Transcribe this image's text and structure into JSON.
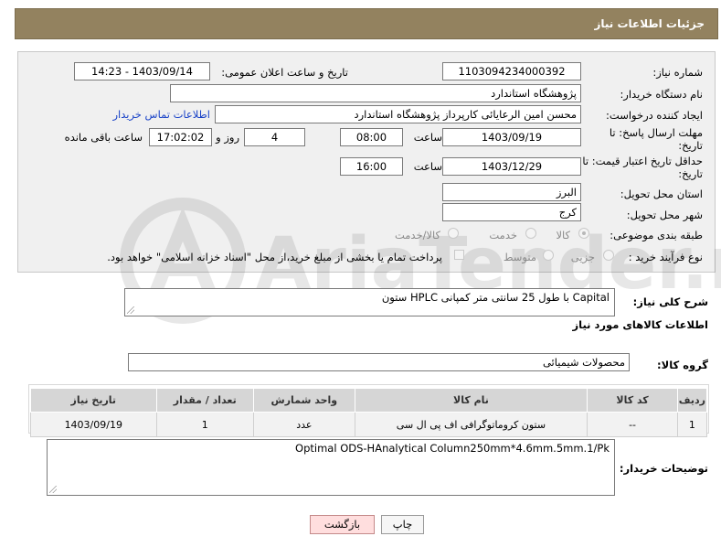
{
  "header": {
    "title": "جزئیات اطلاعات نیاز"
  },
  "form": {
    "need_number_label": "شماره نیاز:",
    "need_number": "1103094234000392",
    "announce_label": "تاریخ و ساعت اعلان عمومی:",
    "announce_value": "1403/09/14 - 14:23",
    "buyer_org_label": "نام دستگاه خریدار:",
    "buyer_org": "پژوهشگاه استاندارد",
    "creator_label": "ایجاد کننده درخواست:",
    "creator": "محسن امین الرعایائی کارپرداز پژوهشگاه استاندارد",
    "contact_link": "اطلاعات تماس خریدار",
    "reply_deadline_label": "مهلت ارسال پاسخ: تا تاریخ:",
    "reply_date": "1403/09/19",
    "time_label": "ساعت",
    "reply_time": "08:00",
    "days": "4",
    "days_label": "روز و",
    "remaining_time": "17:02:02",
    "remaining_label": "ساعت باقی مانده",
    "price_deadline_label": "حداقل تاریخ اعتبار قیمت: تا تاریخ:",
    "price_date": "1403/12/29",
    "price_time": "16:00",
    "province_label": "استان محل تحویل:",
    "province": "البرز",
    "city_label": "شهر محل تحویل:",
    "city": "کرج",
    "category_label": "طبقه بندی موضوعی:",
    "category_options": [
      "کالا",
      "خدمت",
      "کالا/خدمت"
    ],
    "process_label": "نوع فرآیند خرید :",
    "process_options": [
      "جزیی",
      "متوسط"
    ],
    "payment_note": "پرداخت تمام یا بخشی از مبلغ خرید،از محل \"اسناد خزانه اسلامی\" خواهد بود."
  },
  "description": {
    "label": "شرح کلی نیاز:",
    "text": "ستون HPLC با طول 25 سانتی متر کمپانی Capital"
  },
  "goods": {
    "section_title": "اطلاعات کالاهای مورد نیاز",
    "group_label": "گروه کالا:",
    "group_value": "محصولات شیمیائی",
    "columns": [
      "ردیف",
      "کد کالا",
      "نام کالا",
      "واحد شمارش",
      "تعداد / مقدار",
      "تاریخ نیاز"
    ],
    "rows": [
      {
        "row": "1",
        "code": "--",
        "name": "ستون کروماتوگرافی اف پی ال سی",
        "unit": "عدد",
        "qty": "1",
        "date": "1403/09/19"
      }
    ]
  },
  "buyer_notes": {
    "label": "توضیحات خریدار:",
    "text": "Optimal ODS-HAnalytical Column250mm*4.6mm.5mm.1/Pk"
  },
  "buttons": {
    "print": "چاپ",
    "back": "بازگشت"
  },
  "watermark": {
    "text": "AriaTender.net"
  }
}
